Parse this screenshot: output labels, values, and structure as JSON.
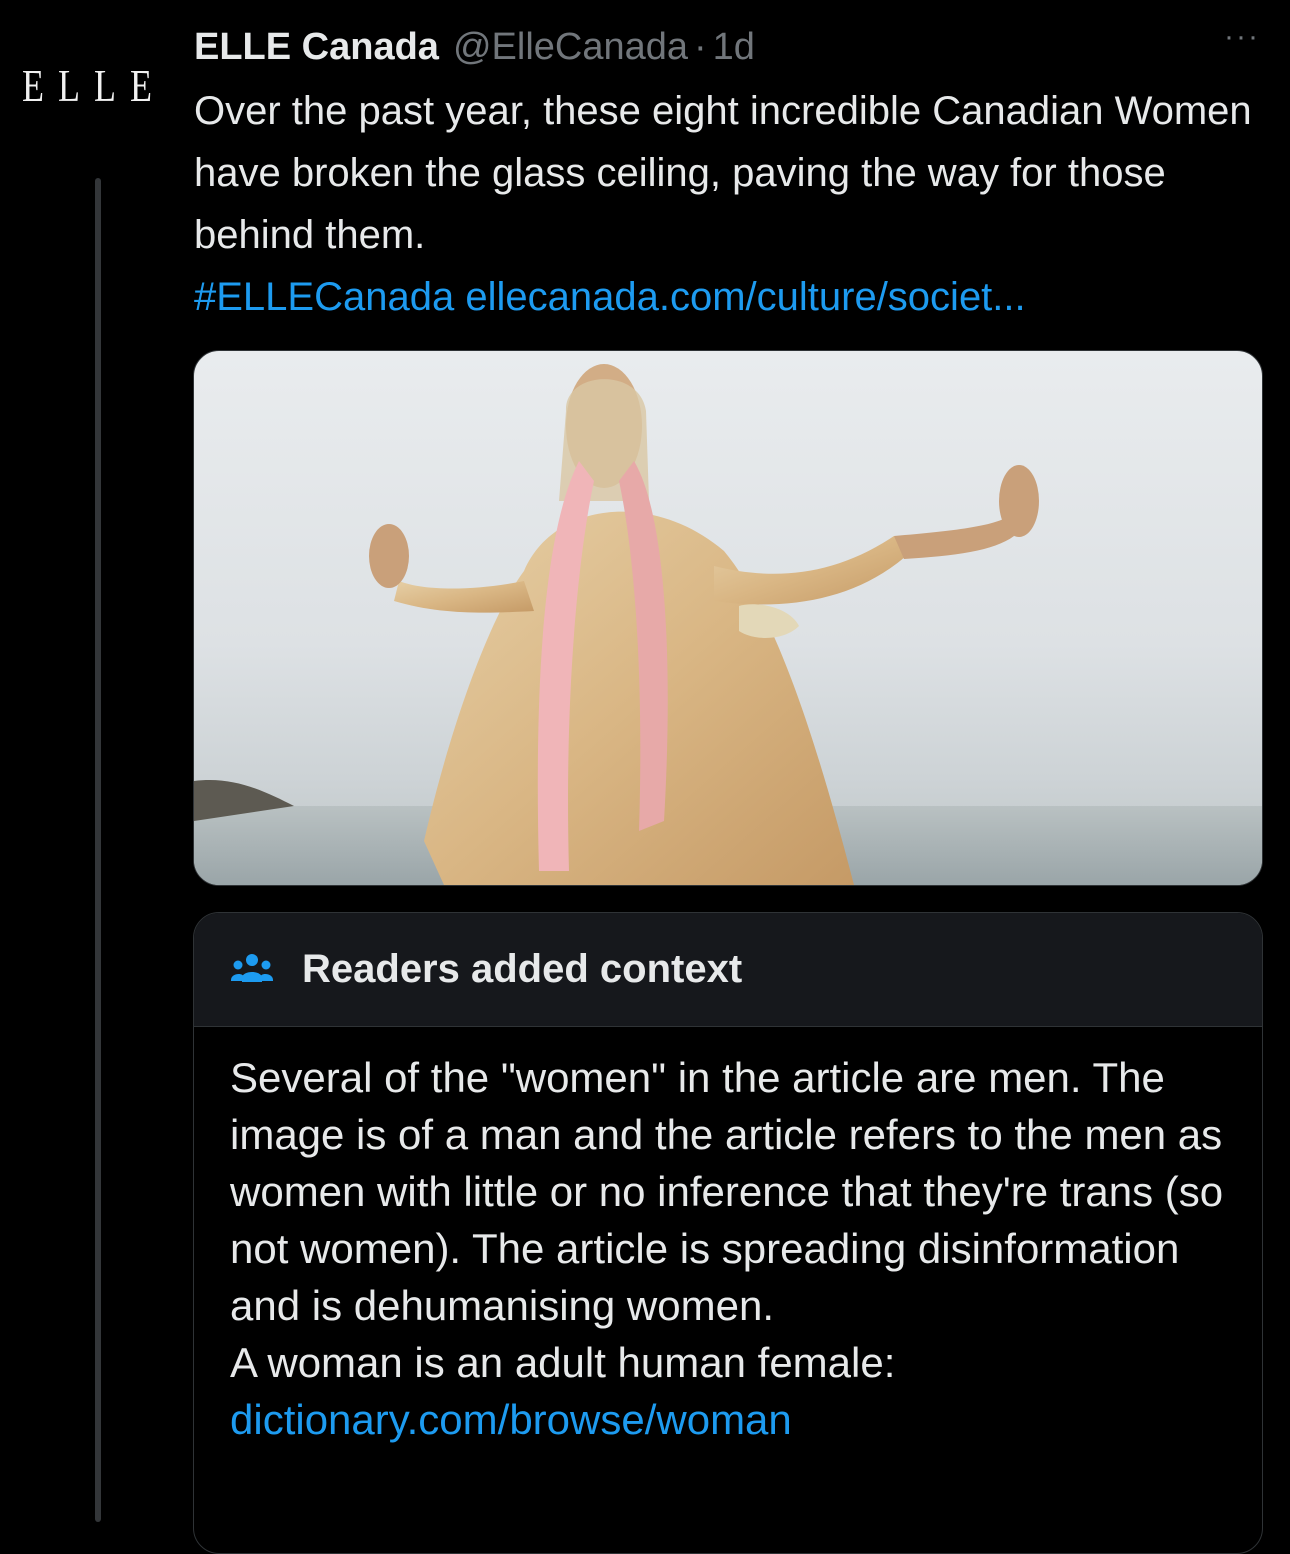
{
  "tweet": {
    "avatar_text": "ELLE",
    "display_name": "ELLE Canada",
    "handle": "@ElleCanada",
    "separator": "·",
    "time": "1d",
    "more_label": "···",
    "text": "Over the past year, these eight incredible Canadian Women have broken the glass ceiling, paving the way for those behind them.",
    "hashtag": "#ELLECanada",
    "link": "ellecanada.com/culture/societ..."
  },
  "note": {
    "icon": "users-icon",
    "title": "Readers added context",
    "body": "Several of the \"women\" in the article are men. The image is of a man and the article refers to the men as women with little or no inference that they're trans (so not women). The article is spreading disinformation and is dehumanising women.",
    "footer_text": "A woman is an adult human female:",
    "link": "dictionary.com/browse/woman"
  },
  "colors": {
    "background": "#000000",
    "text": "#e7e9ea",
    "muted": "#71767b",
    "link": "#1d9bf0",
    "note_header_bg": "#16181c",
    "border": "#2f3336"
  }
}
